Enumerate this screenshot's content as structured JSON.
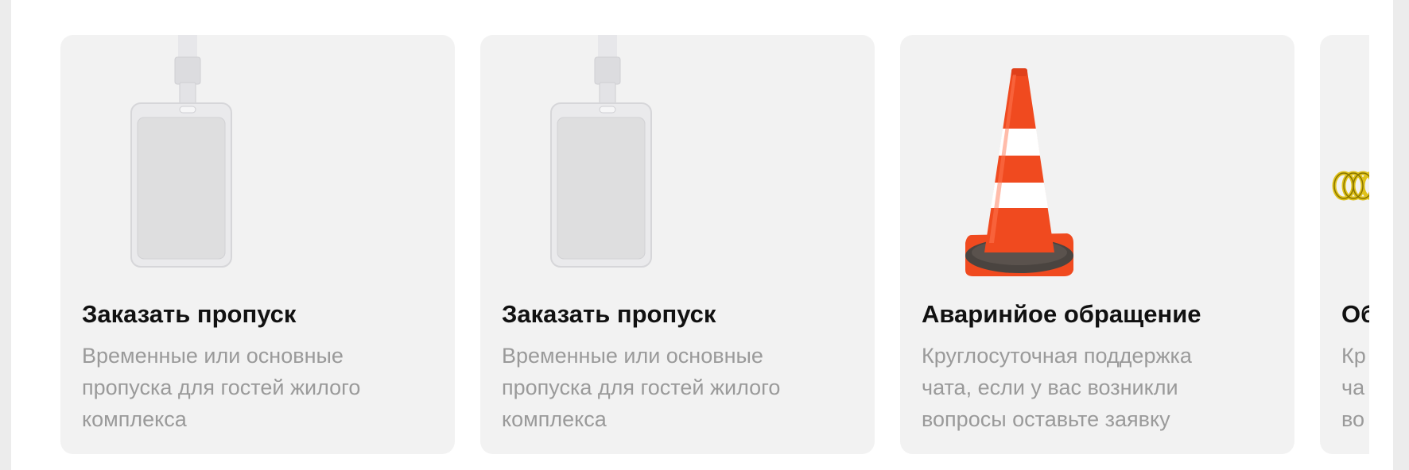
{
  "services": {
    "cards": [
      {
        "title": "Заказать пропуск",
        "description": [
          "Временные или основные",
          "пропуска для гостей жилого",
          "комплекса"
        ],
        "icon": "badge-holder-icon"
      },
      {
        "title": "Заказать пропуск",
        "description": [
          "Временные или основные",
          "пропуска для гостей жилого",
          "комплекса"
        ],
        "icon": "badge-holder-icon"
      },
      {
        "title": "Аваринйое обращение",
        "description": [
          "Круглосуточная поддержка",
          "чата, если у вас возникли",
          "вопросы оставьте заявку"
        ],
        "icon": "traffic-cone-icon"
      },
      {
        "title": "Об",
        "description": [
          "Кр",
          "ча",
          "во"
        ],
        "icon": "coiled-cable-icon"
      }
    ]
  },
  "colors": {
    "card_background": "#f2f2f2",
    "title": "#111111",
    "description": "#9a9a9a",
    "cone_orange": "#f04a1f"
  }
}
